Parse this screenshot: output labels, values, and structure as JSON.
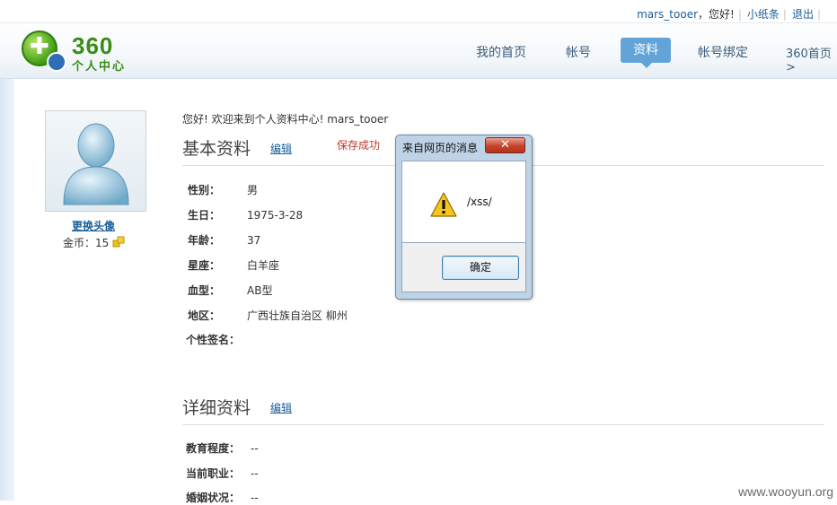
{
  "topbar": {
    "username": "mars_tooer",
    "greeting": "，您好!",
    "notes_link": "小纸条",
    "logout_link": "退出"
  },
  "logo": {
    "number": "360",
    "subtitle": "个人中心"
  },
  "nav": {
    "items": [
      "我的首页",
      "帐号",
      "资料",
      "帐号绑定"
    ],
    "home_link": "360首页>"
  },
  "sidebar": {
    "change_avatar": "更换头像",
    "coins_label": "金币：",
    "coins_value": "15"
  },
  "welcome": "您好! 欢迎来到个人资料中心!  mars_tooer",
  "basic": {
    "title": "基本资料",
    "edit": "编辑",
    "saved_msg": "保存成功",
    "rows": [
      {
        "label": "性别：",
        "value": "男"
      },
      {
        "label": "生日：",
        "value": "1975-3-28"
      },
      {
        "label": "年龄：",
        "value": "37"
      },
      {
        "label": "星座：",
        "value": "白羊座"
      },
      {
        "label": "血型：",
        "value": "AB型"
      },
      {
        "label": "地区：",
        "value": "广西壮族自治区 柳州"
      },
      {
        "label": "个性签名：",
        "value": ""
      }
    ]
  },
  "detail": {
    "title": "详细资料",
    "edit": "编辑",
    "rows": [
      {
        "label": "教育程度：",
        "value": "--"
      },
      {
        "label": "当前职业：",
        "value": "--"
      },
      {
        "label": "婚姻状况：",
        "value": "--"
      }
    ]
  },
  "dialog": {
    "title": "来自网页的消息",
    "close": "✕",
    "message": "/xss/",
    "ok": "确定"
  },
  "watermark": "www.wooyun.org",
  "colors": {
    "nav_active_bg": "#62a4d8",
    "link": "#1a5e9a",
    "saved": "#c0392b",
    "logo_green": "#3a8d17"
  }
}
